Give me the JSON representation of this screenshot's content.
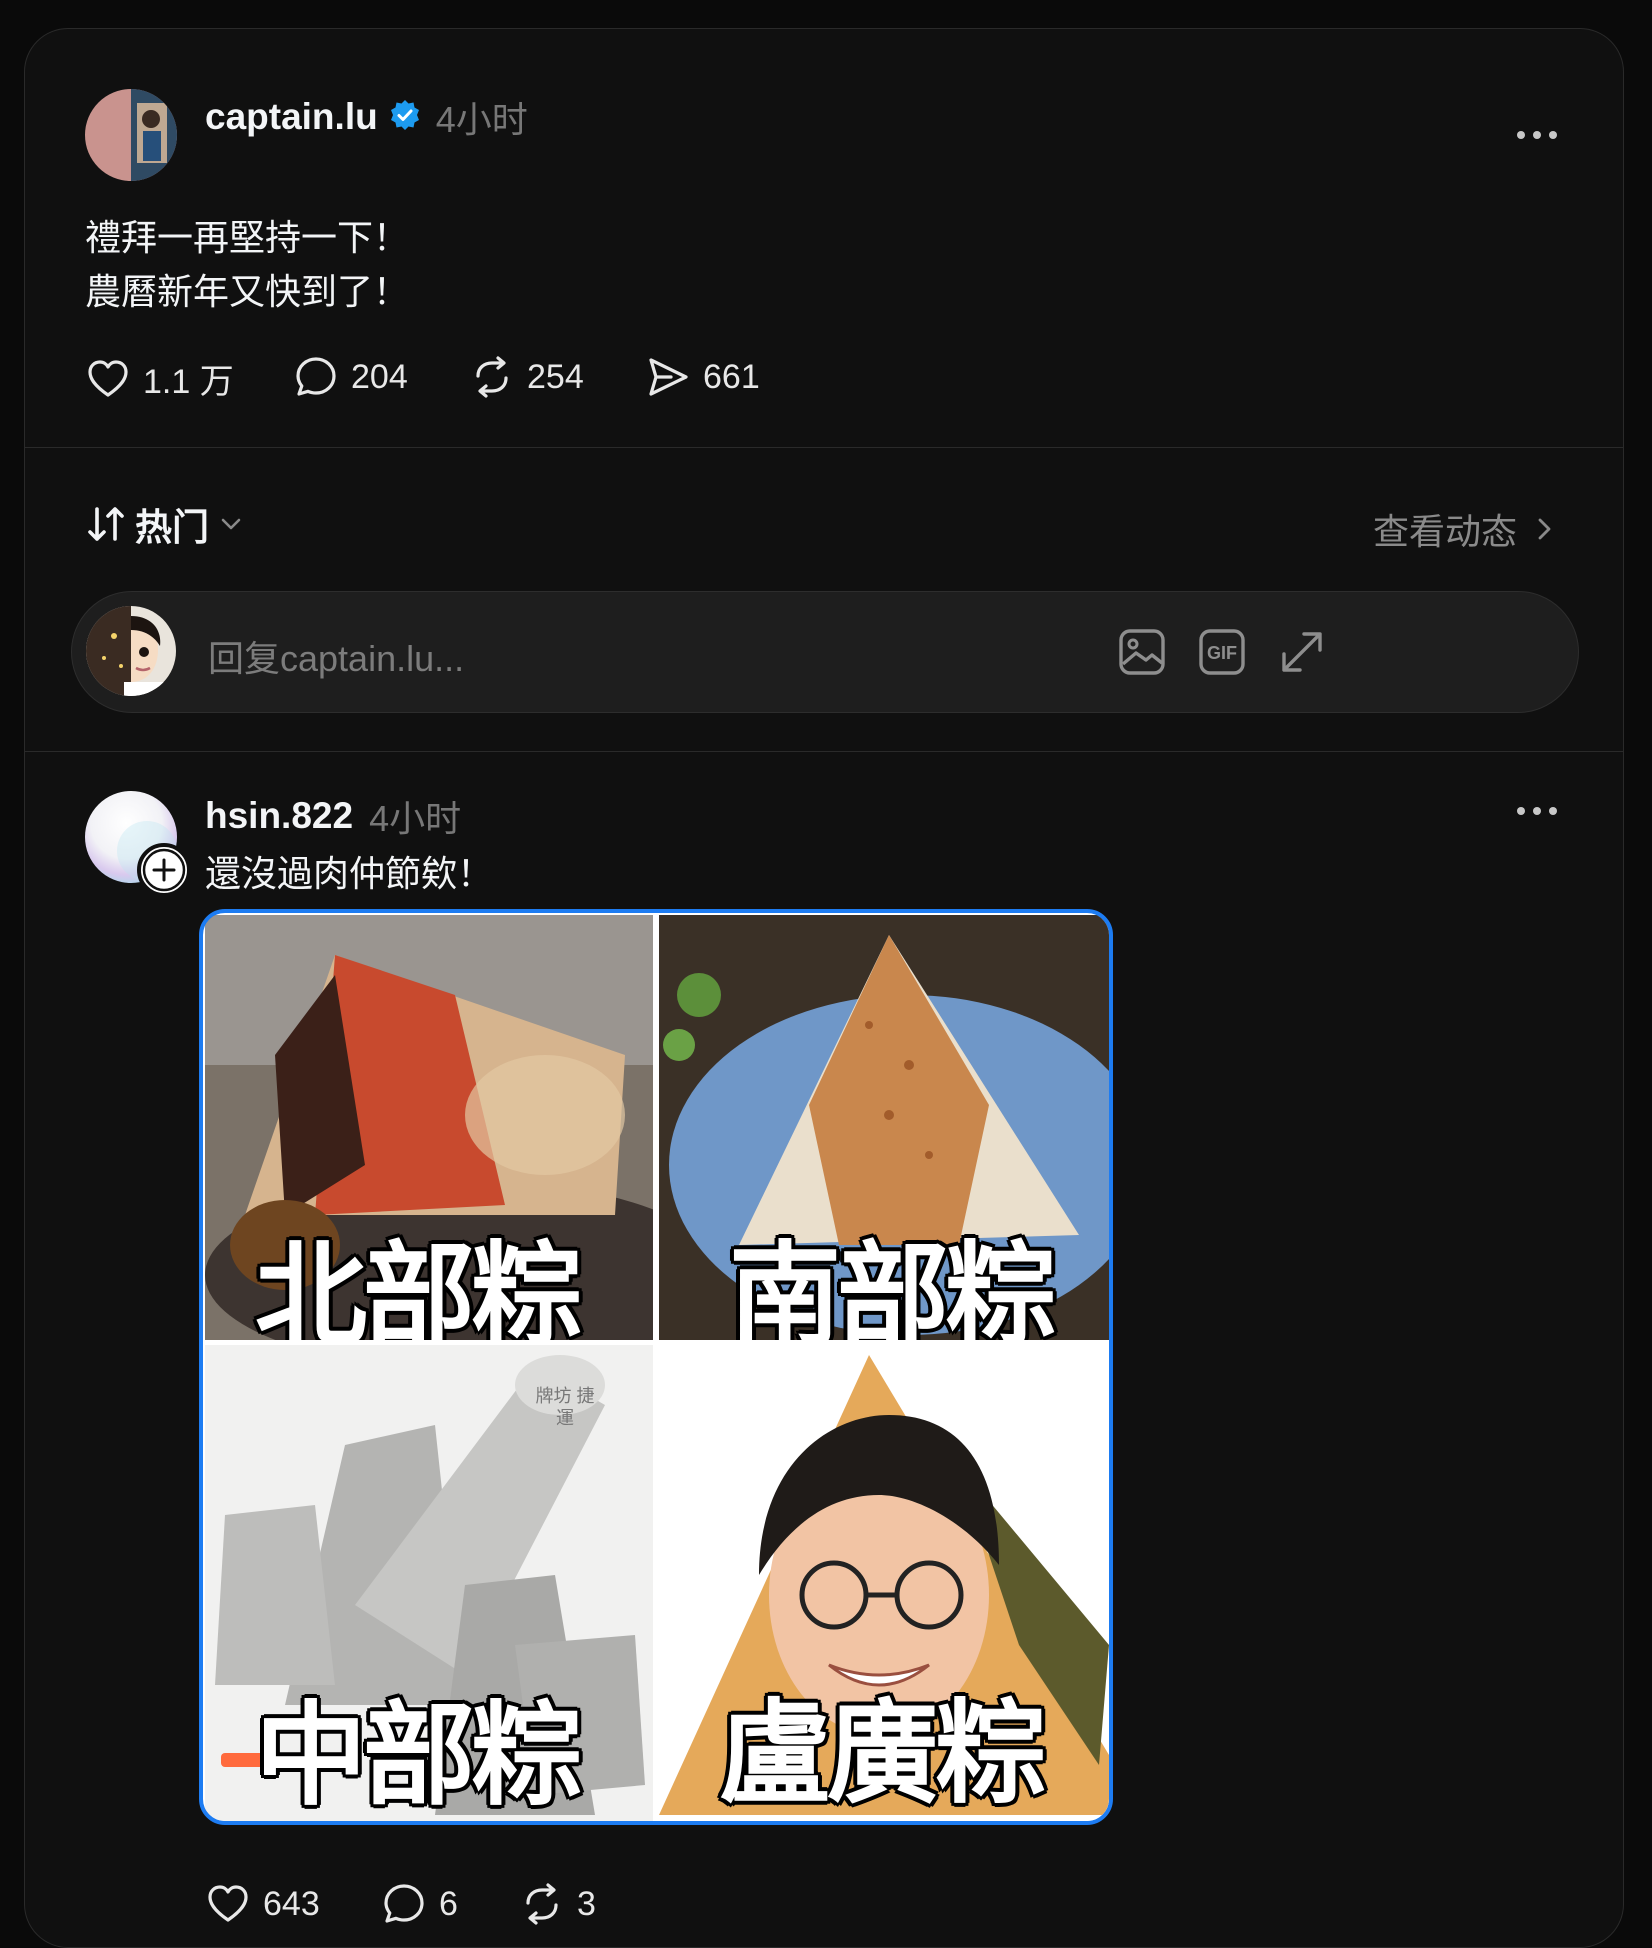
{
  "post": {
    "username": "captain.lu",
    "verified": true,
    "time": "4小时",
    "lines": [
      "禮拜一再堅持一下！",
      "農曆新年又快到了！"
    ],
    "likes": "1.1 万",
    "comments": "204",
    "reposts": "254",
    "shares": "661"
  },
  "sort": {
    "label": "热门",
    "view_activity": "查看动态"
  },
  "reply": {
    "placeholder": "回复captain.lu...",
    "gif_label": "GIF"
  },
  "comment": {
    "username": "hsin.822",
    "time": "4小时",
    "text": "還沒過肉仲節欸！",
    "meme": {
      "north": "北部粽",
      "south": "南部粽",
      "central": "中部粽",
      "lu": "盧廣粽",
      "stamp": "牌坊 捷運"
    },
    "likes": "643",
    "comments": "6",
    "reposts": "3"
  },
  "colors": {
    "verified": "#1d9bf0",
    "image_border": "#1d7cf2",
    "background": "#101010"
  }
}
